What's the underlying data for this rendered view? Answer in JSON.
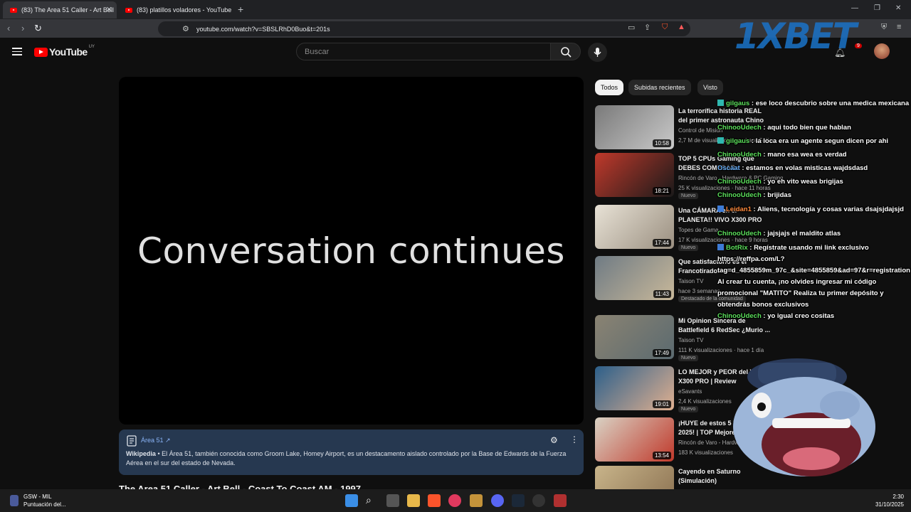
{
  "browser": {
    "tabs": [
      {
        "label": "(83) The Area 51 Caller - Art Bell",
        "active": true
      },
      {
        "label": "(83) platillos voladores - YouTube",
        "active": false
      }
    ],
    "url": "youtube.com/watch?v=SBSLRhD0Buo&t=201s"
  },
  "youtube": {
    "logo_text": "YouTube",
    "country_code": "UY",
    "search_placeholder": "Buscar",
    "notifications_count": "9"
  },
  "player": {
    "overlay_text": "Conversation continues"
  },
  "info_panel": {
    "title": "Área 51",
    "text_source": "Wikipedia",
    "text": " • El Área 51, también conocida como Groom Lake, Homey Airport, es un destacamento aislado controlado por la Base de Edwards de la Fuerza Aérea en el sur del estado de Nevada."
  },
  "video_title": "The Area 51 Caller - Art Bell - Coast To Coast AM - 1997",
  "filters": [
    "Todos",
    "Subidas recientes",
    "Visto"
  ],
  "recommendations": [
    {
      "title": "La terrorífica historia REAL del primer astronauta Chino",
      "channel": "Control de Misión",
      "meta": "2,7 M de visualizaciones · hace 5 días",
      "duration": "10:58",
      "badge": "",
      "colors": [
        "#7a7a7a",
        "#c9c9c9"
      ]
    },
    {
      "title": "TOP 5 CPUs Gaming que DEBES COMPRAR",
      "channel": "Rincón de Varo - Hardware & PC Gaming",
      "meta": "25 K visualizaciones · hace 11 horas",
      "duration": "18:21",
      "badge": "Nuevo",
      "colors": [
        "#c0392b",
        "#1a1a1a"
      ]
    },
    {
      "title": "Una CÁMARA en el PLANETA!! VIVO X300 PRO",
      "channel": "Topes de Gama",
      "meta": "17 K visualizaciones · hace 9 horas",
      "duration": "17:44",
      "badge": "Nuevo",
      "colors": [
        "#e8e2d6",
        "#9a8f80"
      ]
    },
    {
      "title": "Que satisfactorio es el Francotirador",
      "channel": "Taison TV",
      "meta": "hace 3 semanas",
      "duration": "11:43",
      "badge": "Destacado de la comunidad",
      "colors": [
        "#6f7b84",
        "#c8b89a"
      ]
    },
    {
      "title": "Mi Opinion Sincera de Battlefield 6 RedSec ¿Murio ...",
      "channel": "Taison TV",
      "meta": "111 K visualizaciones · hace 1 día",
      "duration": "17:49",
      "badge": "Nuevo",
      "colors": [
        "#8a8372",
        "#5b6a70"
      ]
    },
    {
      "title": "LO MEJOR y PEOR del VIVO X300 PRO | Review",
      "channel": "eSavants",
      "meta": "2,4 K visualizaciones",
      "duration": "19:01",
      "badge": "Nuevo",
      "colors": [
        "#2c5f8a",
        "#e0b090"
      ]
    },
    {
      "title": "¡HUYE de estos 5 PCs en 2025! | TOP Mejores",
      "channel": "Rincón de Varo - Hardware",
      "meta": "183 K visualizaciones",
      "duration": "13:54",
      "badge": "",
      "colors": [
        "#d9d2c4",
        "#c0392b"
      ]
    },
    {
      "title": "Cayendo en Saturno (Simulación)",
      "channel": "",
      "meta": "",
      "duration": "",
      "badge": "",
      "colors": [
        "#c8b48a",
        "#8a7050"
      ]
    }
  ],
  "chat": [
    {
      "user": "gilgaus",
      "text": " : ese loco descubrio sobre una medica mexicana",
      "color": "green",
      "icon": "teal"
    },
    {
      "user": "ChinooUdech",
      "text": " : aqui todo bien que hablan",
      "color": "green",
      "icon": ""
    },
    {
      "user": "gilgaus",
      "text": " : la loca era un agente segun dicen por ahi",
      "color": "green",
      "icon": "teal"
    },
    {
      "user": "ChinooUdech",
      "text": " : mano esa wea es verdad",
      "color": "green",
      "icon": ""
    },
    {
      "user": "Oscaat",
      "text": " : estamos en volas misticas wajdsdasd",
      "color": "blue",
      "icon": ""
    },
    {
      "user": "ChinooUdech",
      "text": " : yo eh vito weas brigijas",
      "color": "green",
      "icon": ""
    },
    {
      "user": "ChinooUdech",
      "text": " : brijidas",
      "color": "green",
      "icon": ""
    },
    {
      "user": "Leidan1",
      "text": " : Aliens, tecnología y cosas varias dsajsjdajsjd",
      "color": "orange",
      "icon": "blue"
    },
    {
      "user": "ChinooUdech",
      "text": " : jajsjajs el maldito atlas",
      "color": "green",
      "icon": ""
    },
    {
      "user": "BotRix",
      "text": " : Regístrate usando mi link exclusivo https://reffpa.com/L?tag=d_4855859m_97c_&site=4855859&ad=97&r=registration Al crear tu cuenta, ¡no olvides ingresar mi código promocional \"MATITO\" Realiza tu primer depósito y obtendrás bonos exclusivos",
      "color": "green",
      "icon": "blue"
    },
    {
      "user": "ChinooUdech",
      "text": " : yo igual creo cositas",
      "color": "green",
      "icon": ""
    }
  ],
  "overlay_brand": "1XBET",
  "taskbar": {
    "widget_title": "GSW - MIL",
    "widget_subtitle": "Puntuación del...",
    "time": "2:30",
    "date": "31/10/2025"
  }
}
